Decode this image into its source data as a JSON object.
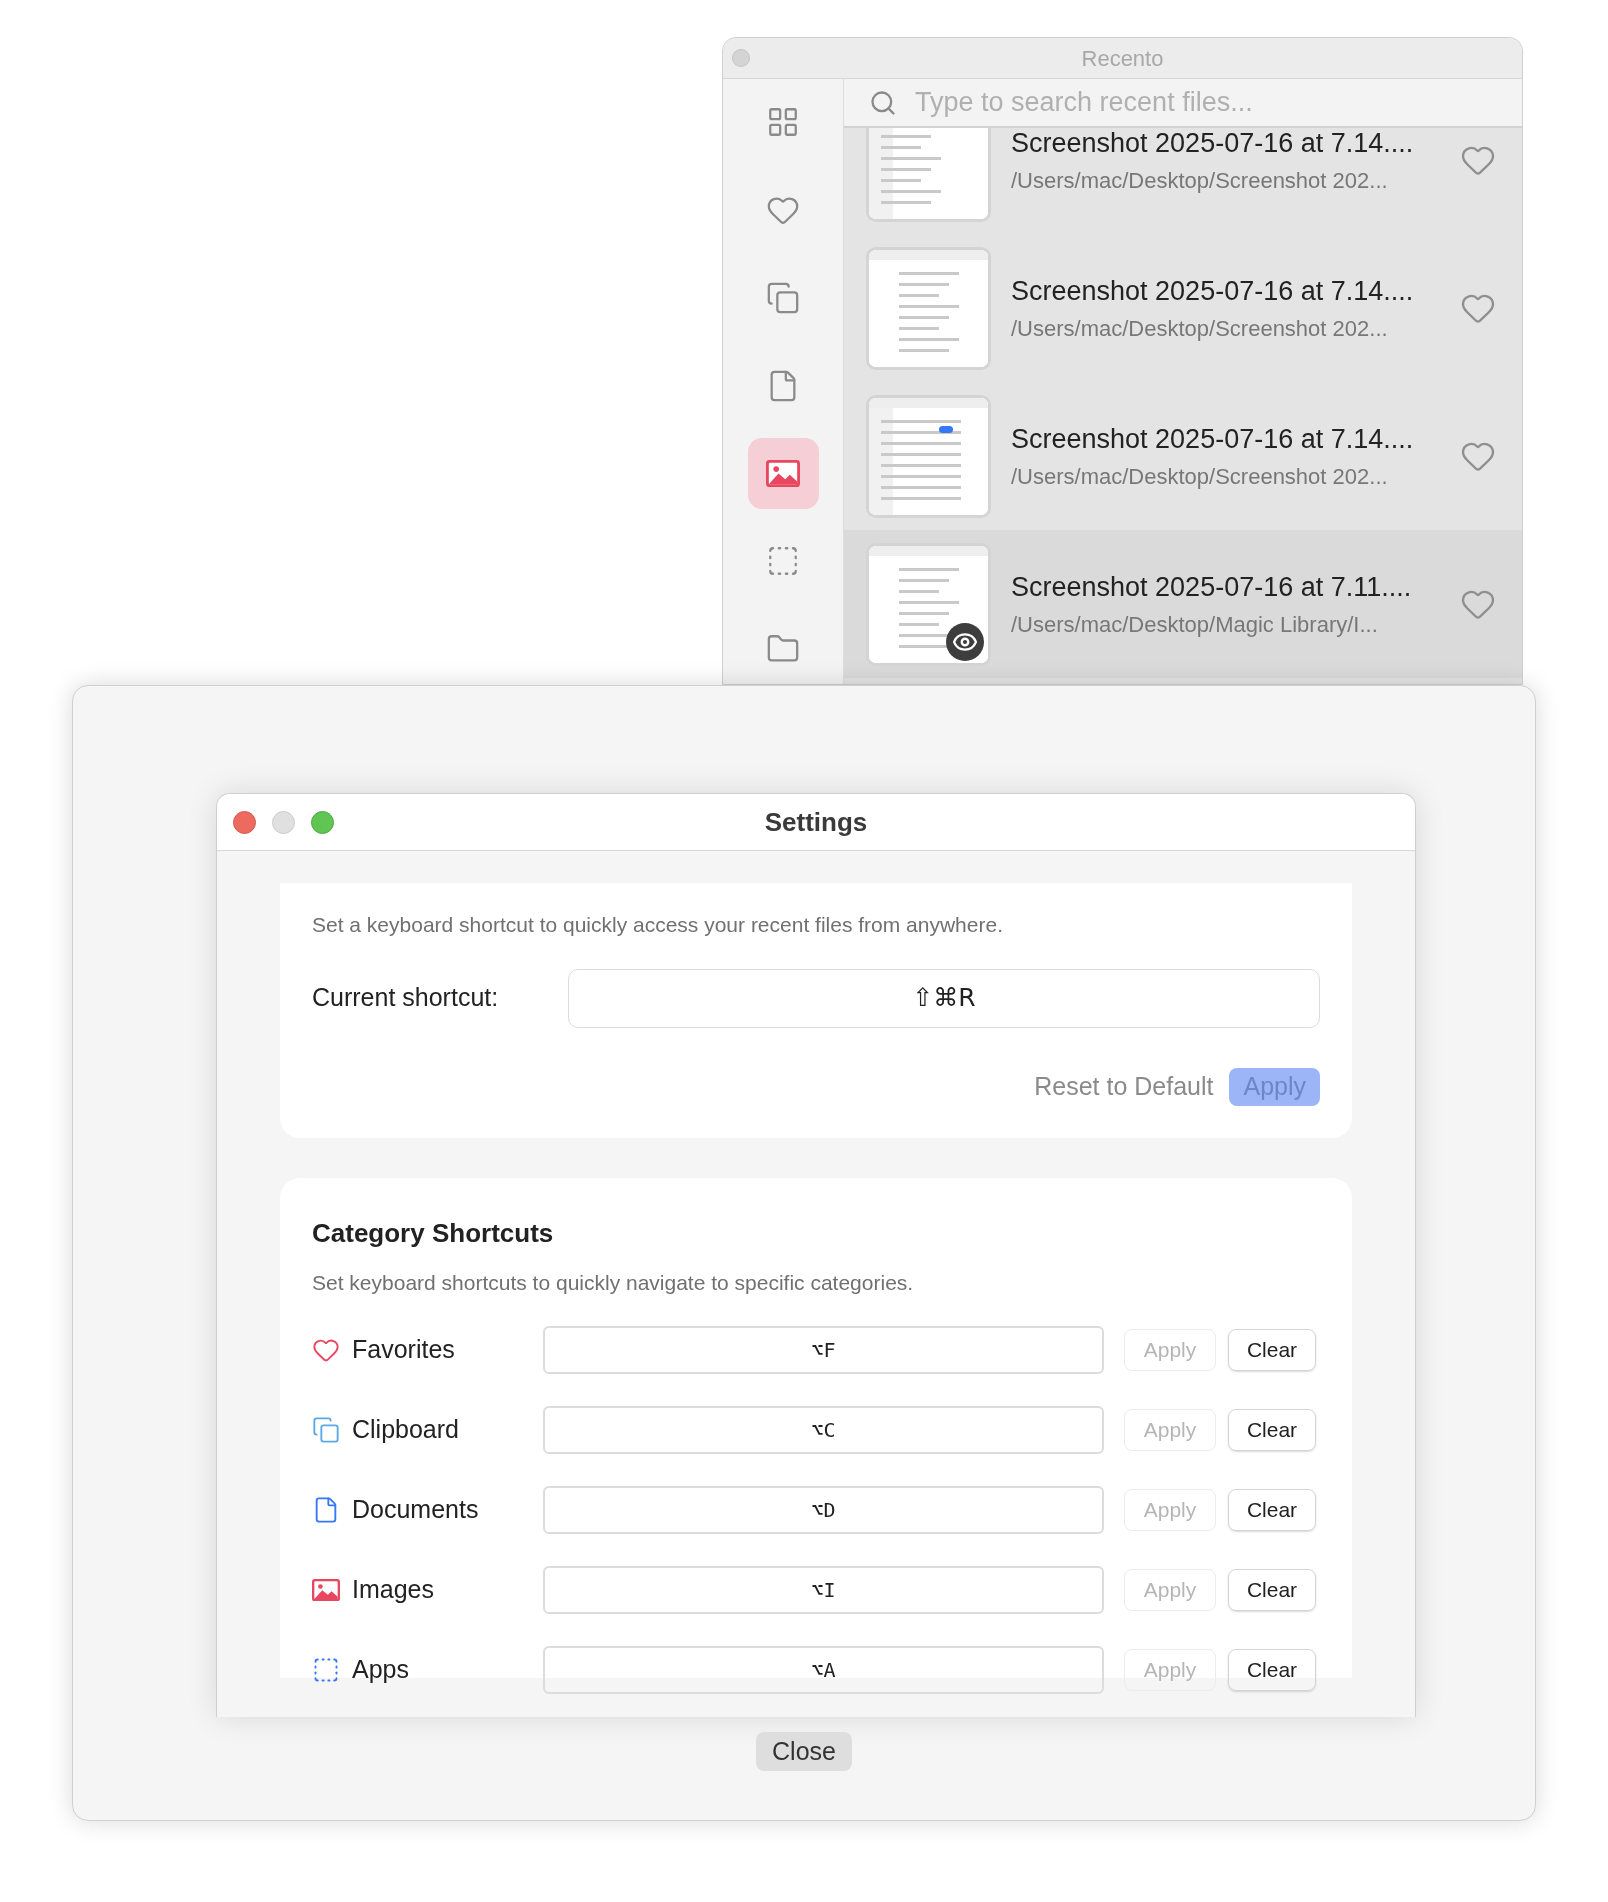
{
  "recento": {
    "title": "Recento",
    "search": {
      "placeholder": "Type to search recent files..."
    },
    "sidebar": [
      {
        "kind": "all",
        "selected": false
      },
      {
        "kind": "favorites",
        "selected": false
      },
      {
        "kind": "clipboard",
        "selected": false
      },
      {
        "kind": "documents",
        "selected": false
      },
      {
        "kind": "images",
        "selected": true
      },
      {
        "kind": "apps",
        "selected": false
      },
      {
        "kind": "folders",
        "selected": false
      }
    ],
    "files": [
      {
        "title": "Screenshot 2025-07-16 at 7.14....",
        "path": "/Users/mac/Desktop/Screenshot 202...",
        "favorite": false,
        "selected": false
      },
      {
        "title": "Screenshot 2025-07-16 at 7.14....",
        "path": "/Users/mac/Desktop/Screenshot 202...",
        "favorite": false,
        "selected": false
      },
      {
        "title": "Screenshot 2025-07-16 at 7.14....",
        "path": "/Users/mac/Desktop/Screenshot 202...",
        "favorite": false,
        "selected": false
      },
      {
        "title": "Screenshot 2025-07-16 at 7.11....",
        "path": "/Users/mac/Desktop/Magic Library/I...",
        "favorite": false,
        "selected": true
      }
    ]
  },
  "settings": {
    "title": "Settings",
    "global_shortcut": {
      "description": "Set a keyboard shortcut to quickly access your recent files from anywhere.",
      "label": "Current shortcut:",
      "value": "⇧⌘R",
      "reset": "Reset to Default",
      "apply": {
        "label": "Apply",
        "disabled": true
      }
    },
    "category_shortcuts": {
      "heading": "Category Shortcuts",
      "description": "Set keyboard shortcuts to quickly navigate to specific categories.",
      "rows": [
        {
          "kind": "favorites",
          "label": "Favorites",
          "value": "⌥F",
          "apply": "Apply",
          "apply_disabled": true,
          "clear": "Clear"
        },
        {
          "kind": "clipboard",
          "label": "Clipboard",
          "value": "⌥C",
          "apply": "Apply",
          "apply_disabled": true,
          "clear": "Clear"
        },
        {
          "kind": "documents",
          "label": "Documents",
          "value": "⌥D",
          "apply": "Apply",
          "apply_disabled": true,
          "clear": "Clear"
        },
        {
          "kind": "images",
          "label": "Images",
          "value": "⌥I",
          "apply": "Apply",
          "apply_disabled": true,
          "clear": "Clear"
        },
        {
          "kind": "apps",
          "label": "Apps",
          "value": "⌥A",
          "apply": "Apply",
          "apply_disabled": true,
          "clear": "Clear"
        }
      ]
    }
  },
  "close": "Close"
}
